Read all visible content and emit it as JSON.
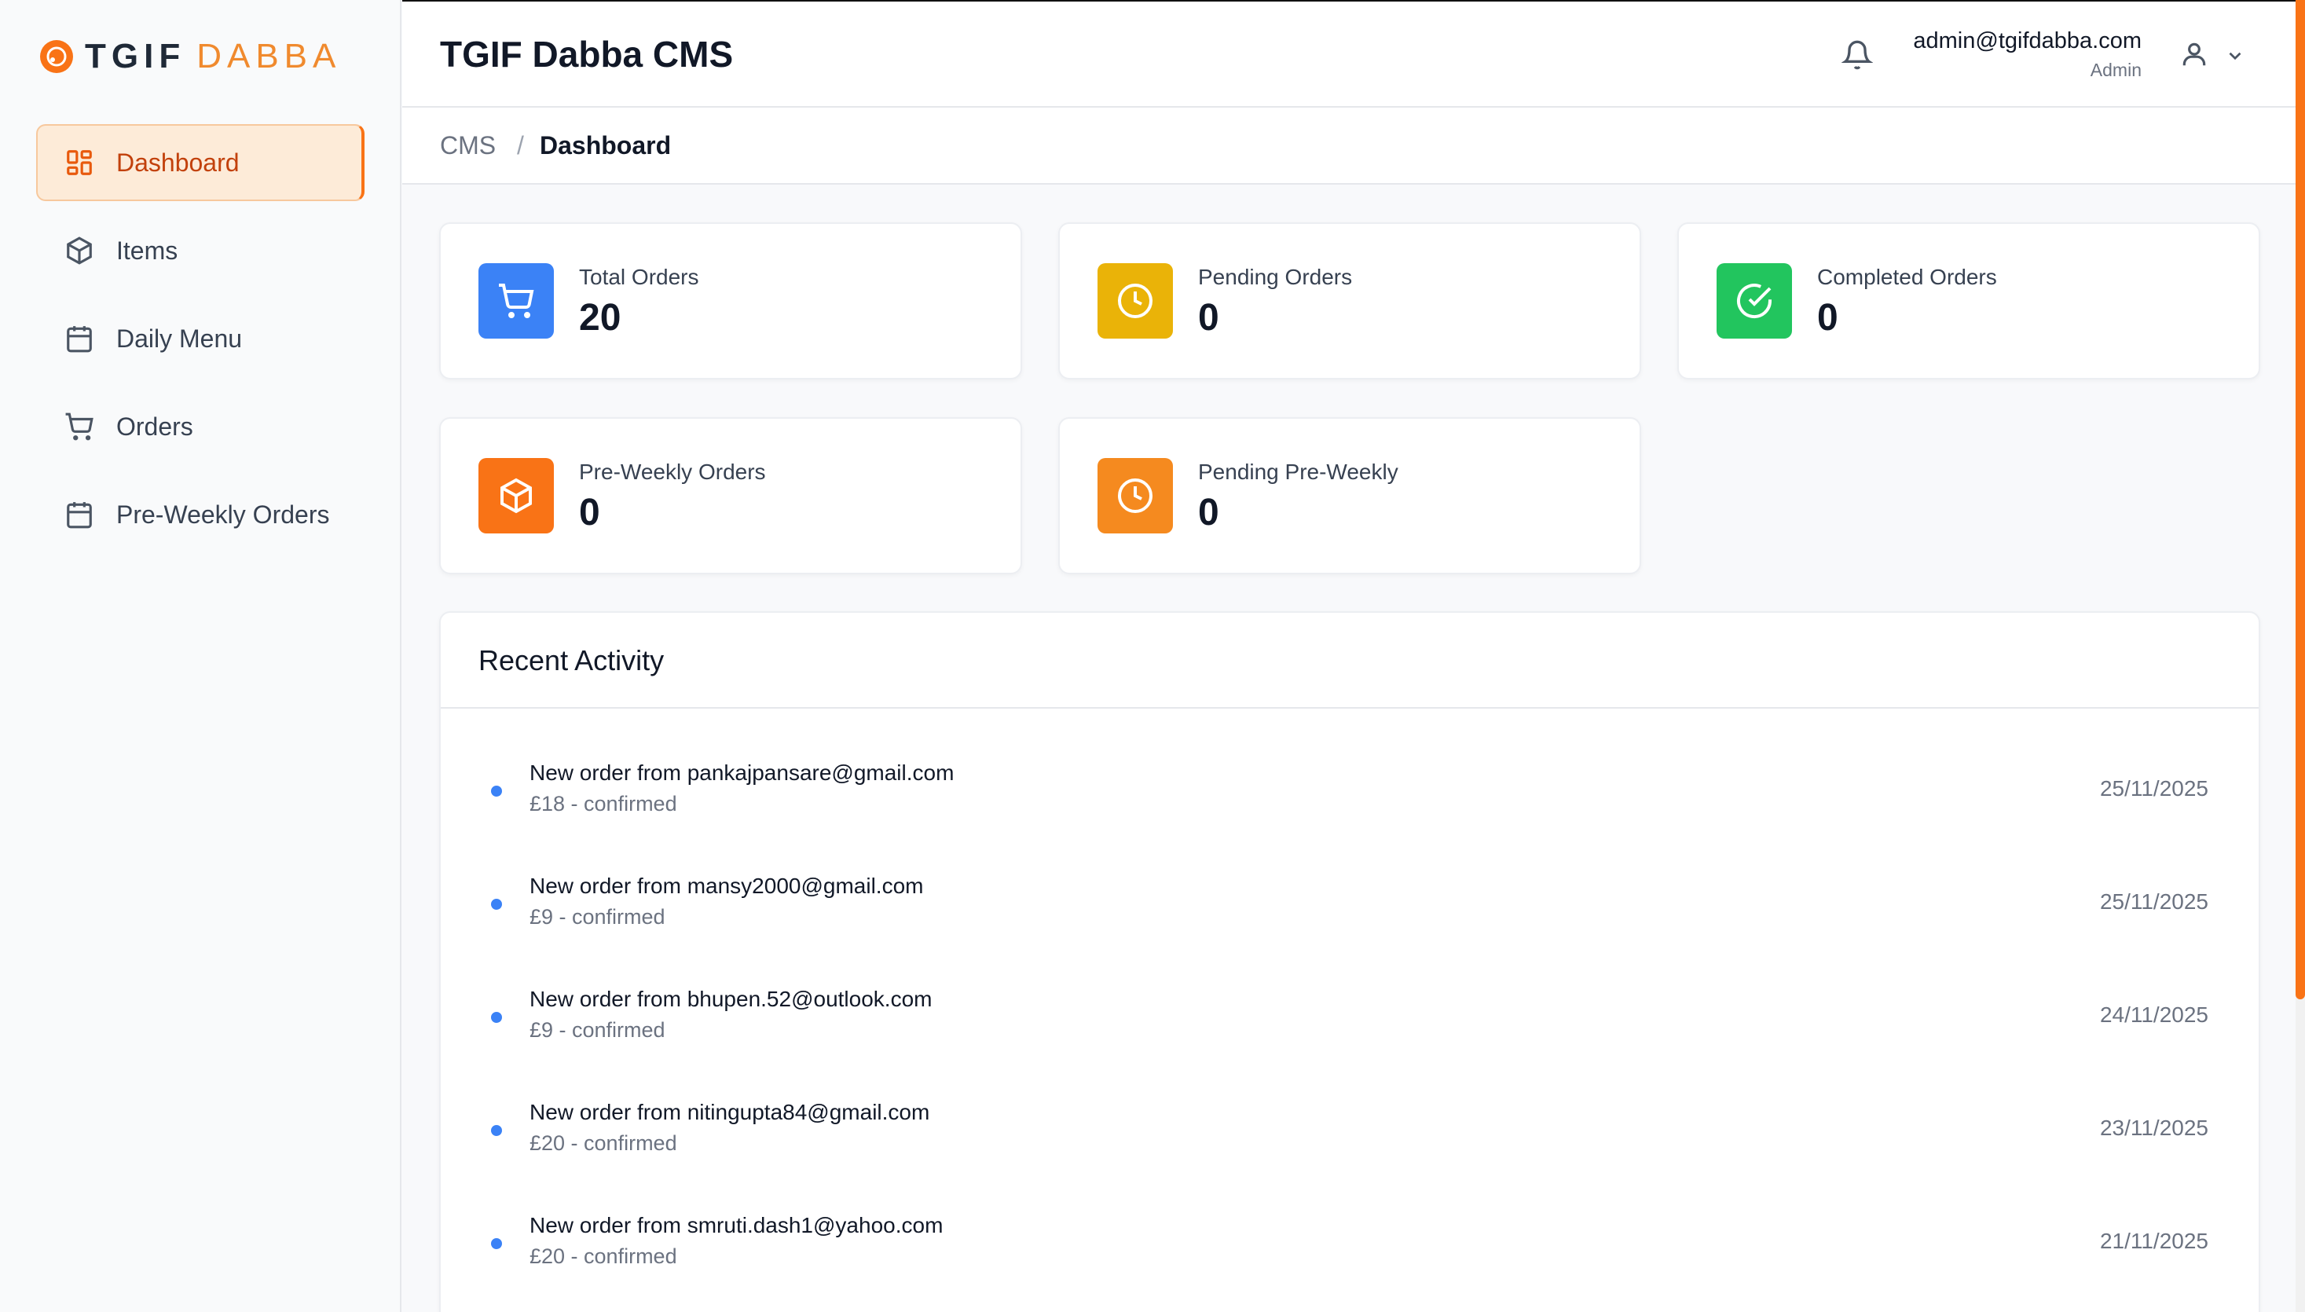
{
  "brand": {
    "name_part1": "TGIF",
    "name_part2": "DABBA",
    "accent": "#f97316"
  },
  "sidebar": {
    "items": [
      {
        "label": "Dashboard",
        "icon": "dashboard-grid-icon",
        "active": true
      },
      {
        "label": "Items",
        "icon": "box-icon",
        "active": false
      },
      {
        "label": "Daily Menu",
        "icon": "calendar-icon",
        "active": false
      },
      {
        "label": "Orders",
        "icon": "cart-icon",
        "active": false
      },
      {
        "label": "Pre-Weekly Orders",
        "icon": "calendar-grid-icon",
        "active": false
      }
    ]
  },
  "header": {
    "title": "TGIF Dabba CMS",
    "user_email": "admin@tgifdabba.com",
    "user_role": "Admin"
  },
  "breadcrumb": {
    "root": "CMS",
    "separator": "/",
    "current": "Dashboard"
  },
  "stats": [
    {
      "label": "Total Orders",
      "value": "20",
      "icon": "cart-icon",
      "color": "#3b82f6"
    },
    {
      "label": "Pending Orders",
      "value": "0",
      "icon": "clock-icon",
      "color": "#eab308"
    },
    {
      "label": "Completed Orders",
      "value": "0",
      "icon": "check-circle-icon",
      "color": "#22c55e"
    },
    {
      "label": "Pre-Weekly Orders",
      "value": "0",
      "icon": "box-icon",
      "color": "#f97316"
    },
    {
      "label": "Pending Pre-Weekly",
      "value": "0",
      "icon": "clock-icon",
      "color": "#f58a1f"
    }
  ],
  "activity": {
    "title": "Recent Activity",
    "items": [
      {
        "text": "New order from pankajpansare@gmail.com",
        "detail": "£18 - confirmed",
        "date": "25/11/2025"
      },
      {
        "text": "New order from mansy2000@gmail.com",
        "detail": "£9 - confirmed",
        "date": "25/11/2025"
      },
      {
        "text": "New order from bhupen.52@outlook.com",
        "detail": "£9 - confirmed",
        "date": "24/11/2025"
      },
      {
        "text": "New order from nitingupta84@gmail.com",
        "detail": "£20 - confirmed",
        "date": "23/11/2025"
      },
      {
        "text": "New order from smruti.dash1@yahoo.com",
        "detail": "£20 - confirmed",
        "date": "21/11/2025"
      }
    ]
  }
}
